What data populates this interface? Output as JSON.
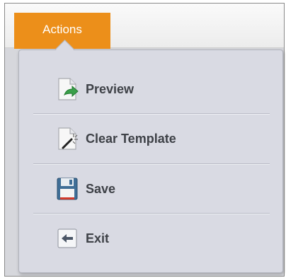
{
  "header": {
    "actions_label": "Actions"
  },
  "menu": {
    "items": [
      {
        "label": "Preview",
        "icon": "preview-icon"
      },
      {
        "label": "Clear Template",
        "icon": "clear-template-icon"
      },
      {
        "label": "Save",
        "icon": "save-icon"
      },
      {
        "label": "Exit",
        "icon": "exit-icon"
      }
    ]
  },
  "colors": {
    "accent": "#ec8f1a",
    "menu_bg": "#d9dae3",
    "text": "#3e4147"
  }
}
